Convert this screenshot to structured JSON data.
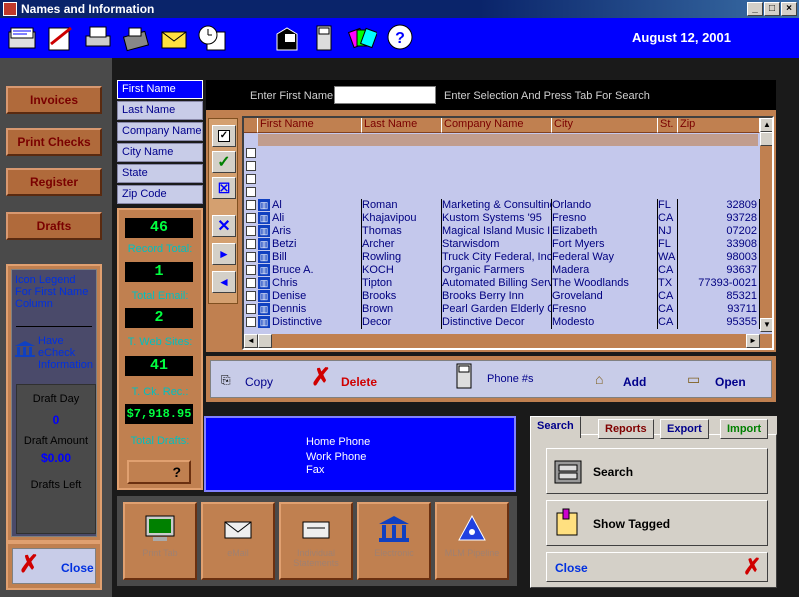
{
  "window": {
    "title": "Names and Information"
  },
  "toolbar": {
    "icons": [
      "rolodex-icon",
      "write-letter-icon",
      "printer-icon",
      "fax-icon",
      "envelope-icon",
      "clock-calendar-icon",
      "mailbox-icon",
      "phone-icon",
      "cards-icon",
      "help-icon"
    ],
    "date": "August 12, 2001"
  },
  "left_nav": {
    "invoices": "Invoices",
    "print_checks": "Print Checks",
    "register": "Register",
    "drafts": "Drafts"
  },
  "legend": {
    "title": "Icon Legend For First Name Column",
    "item_label": "Have eCheck Information",
    "draft_day_label": "Draft Day",
    "draft_day_value": "0",
    "draft_amount_label": "Draft Amount",
    "draft_amount_value": "$0.00",
    "drafts_left_label": "Drafts Left"
  },
  "close_left": "Close",
  "search_fields": [
    "First Name",
    "Last Name",
    "Company Name",
    "City Name",
    "State",
    "Zip Code"
  ],
  "stats": {
    "record_total_value": "46",
    "record_total_label": "Record Total:",
    "total_email_value": "1",
    "total_email_label": "Total Email:",
    "web_sites_value": "2",
    "web_sites_label": "T. Web Sites:",
    "ck_rec_value": "41",
    "ck_rec_label": "T. Ck. Rec.:",
    "drafts_value": "$7,918.95",
    "drafts_label": "Total Drafts:",
    "help_btn": "?"
  },
  "search_header": {
    "label": "Enter First Name:",
    "input_value": "",
    "hint": "Enter Selection And Press Tab For Search"
  },
  "grid": {
    "columns": [
      "First Name",
      "Last Name",
      "Company Name",
      "City",
      "St.",
      "Zip"
    ],
    "rows": [
      {
        "first": "Al",
        "last": "Roman",
        "company": "Marketing & Consulting",
        "city": "Orlando",
        "st": "FL",
        "zip": "32809"
      },
      {
        "first": "Ali",
        "last": "Khajavipou",
        "company": "Kustom Systems '95",
        "city": "Fresno",
        "st": "CA",
        "zip": "93728"
      },
      {
        "first": "Aris",
        "last": "Thomas",
        "company": "Magical Island Music Ir",
        "city": "Elizabeth",
        "st": "NJ",
        "zip": "07202"
      },
      {
        "first": "Betzi",
        "last": "Archer",
        "company": "Starwisdom",
        "city": "Fort Myers",
        "st": "FL",
        "zip": "33908"
      },
      {
        "first": "Bill",
        "last": "Rowling",
        "company": "Truck City Federal, Inc",
        "city": "Federal Way",
        "st": "WA",
        "zip": "98003"
      },
      {
        "first": "Bruce A.",
        "last": "KOCH",
        "company": "Organic Farmers",
        "city": "Madera",
        "st": "CA",
        "zip": "93637"
      },
      {
        "first": "Chris",
        "last": "Tipton",
        "company": "Automated Billing Serv",
        "city": "The Woodlands",
        "st": "TX",
        "zip": "77393-0021"
      },
      {
        "first": "Denise",
        "last": "Brooks",
        "company": "Brooks Berry Inn",
        "city": "Groveland",
        "st": "CA",
        "zip": "85321"
      },
      {
        "first": "Dennis",
        "last": "Brown",
        "company": "Pearl Garden Elderly C",
        "city": "Fresno",
        "st": "CA",
        "zip": "93711"
      },
      {
        "first": "Distinctive",
        "last": "Decor",
        "company": "Distinctive Decor",
        "city": "Modesto",
        "st": "CA",
        "zip": "95355"
      }
    ]
  },
  "actions": {
    "copy": "Copy",
    "delete": "Delete",
    "phone": "Phone #s",
    "add": "Add",
    "open": "Open"
  },
  "phone_info": {
    "home": "Home Phone",
    "work": "Work Phone",
    "fax": "Fax"
  },
  "big_buttons": [
    "Print Tab",
    "eMail",
    "Individual Statements",
    "Electronic",
    "MLM Pipeline"
  ],
  "right_panel": {
    "tabs": [
      "Search",
      "Reports",
      "Export",
      "Import"
    ],
    "search_btn": "Search",
    "show_tagged_btn": "Show Tagged",
    "close_btn": "Close"
  },
  "colors": {
    "copper": "#c08050",
    "navy": "#00008b",
    "toolbar_blue": "#0000ff",
    "led_green": "#00ff40",
    "grid_bg": "#c4c8ec"
  }
}
